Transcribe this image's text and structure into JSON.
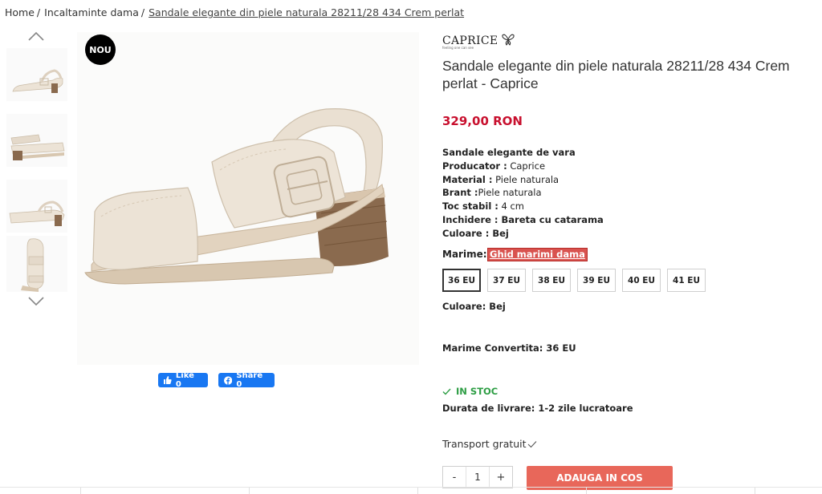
{
  "breadcrumb": {
    "home": "Home",
    "category": "Incaltaminte dama",
    "current": "Sandale elegante din piele naturala 28211/28 434 Crem perlat",
    "separator": "/"
  },
  "gallery": {
    "badge": "NOU",
    "prev_icon": "chevron-up-icon",
    "next_icon": "chevron-down-icon",
    "colors": {
      "leather": "#ece3d6",
      "heel": "#8a6a4e",
      "sole": "#d8c7b0"
    }
  },
  "social": {
    "like_label": "Like 0",
    "share_label": "Share 0",
    "color": "#1877f2"
  },
  "brand": {
    "name": "CAPRICE",
    "tagline": "feeling one can see"
  },
  "product": {
    "title": "Sandale elegante din piele naturala 28211/28 434 Crem perlat - Caprice",
    "price": "329,00 RON",
    "price_color": "#c8102e",
    "specs": {
      "heading": "Sandale elegante de vara",
      "producer_label": "Producator :",
      "producer_value": " Caprice",
      "material_label": "Material :",
      "material_value": " Piele naturala",
      "brant_label": "Brant :",
      "brant_value": "Piele naturala",
      "heel_label": "Toc stabil :",
      "heel_value": " 4 cm",
      "closure_label": "Inchidere :",
      "closure_value": " Bareta cu catarama",
      "color_label": "Culoare :",
      "color_value": " Bej"
    }
  },
  "sizes": {
    "label": "Marime:",
    "guide_link": "Ghid marimi dama",
    "options": [
      "36 EU",
      "37 EU",
      "38 EU",
      "39 EU",
      "40 EU",
      "41 EU"
    ],
    "selected": "36 EU"
  },
  "selection": {
    "color_line": "Culoare: Bej",
    "converted_line": "Marime Convertita: 36 EU"
  },
  "availability": {
    "stock": "IN STOC",
    "stock_color": "#2e9e45",
    "delivery": "Durata de livrare: 1-2 zile lucratoare",
    "transport": "Transport gratuit"
  },
  "cart": {
    "minus": "-",
    "quantity": "1",
    "plus": "+",
    "add_label": "ADAUGA IN COS",
    "button_color": "#e8675a"
  }
}
